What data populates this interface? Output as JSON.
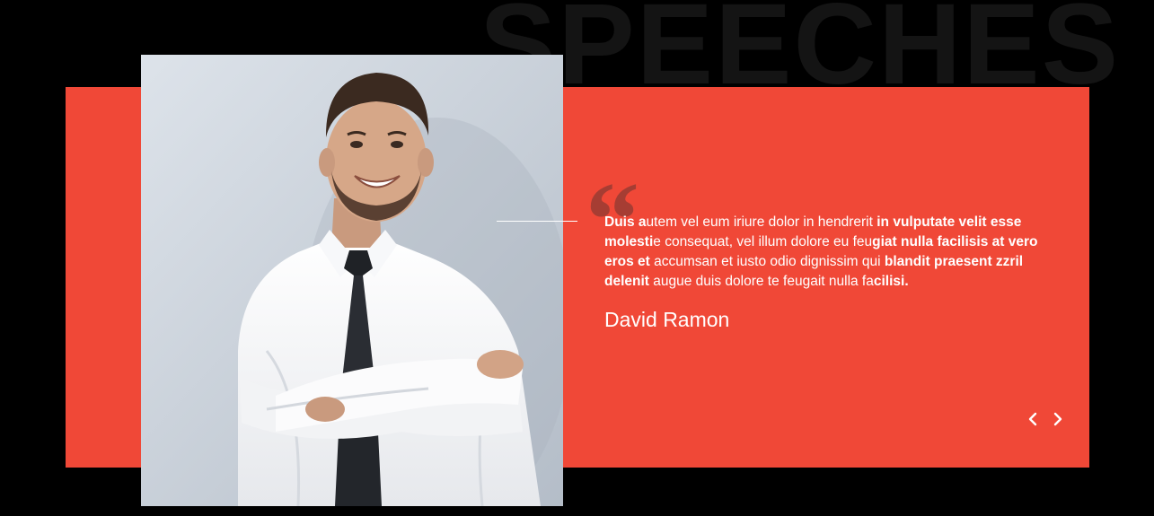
{
  "section": {
    "background_title": "SPEECHES"
  },
  "testimonial": {
    "quote_segments": [
      {
        "text": "Duis a",
        "bold": true
      },
      {
        "text": "utem vel eum iriure dolor in hendrerit ",
        "bold": false
      },
      {
        "text": "in vulputate velit esse molesti",
        "bold": true
      },
      {
        "text": "e consequat, vel illum dolore eu feu",
        "bold": false
      },
      {
        "text": "giat nulla facilisis at vero eros et ",
        "bold": true
      },
      {
        "text": "accumsan et iusto odio dignissim qu",
        "bold": false
      },
      {
        "text": "i ",
        "bold": false
      },
      {
        "text": "blandit praesent zzril delenit",
        "bold": true
      },
      {
        "text": " augue duis dolore te feugait nulla fa",
        "bold": false
      },
      {
        "text": "cilisi.",
        "bold": true
      }
    ],
    "author": "David Ramon"
  },
  "navigation": {
    "prev_icon": "chevron-left-icon",
    "next_icon": "chevron-right-icon"
  },
  "colors": {
    "accent": "#f04837",
    "background": "#000000",
    "bg_title": "#141414",
    "text": "#ffffff"
  }
}
